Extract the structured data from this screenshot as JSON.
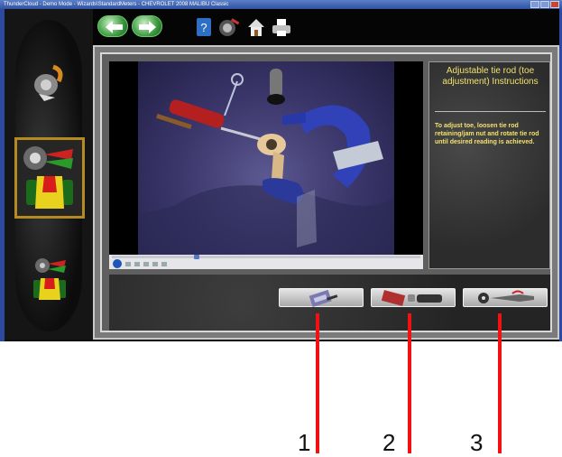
{
  "window": {
    "title": "ThunderCloud - Demo Mode - Wizards\\StandardMeters - CHEVROLET 2008 MALIBU Classic"
  },
  "toolbar": {
    "icons": [
      "back-arrow-icon",
      "forward-arrow-icon",
      "help-icon",
      "wheel-tools-icon",
      "home-icon",
      "printer-icon"
    ]
  },
  "sidebar": {
    "items": [
      {
        "icon": "wheel-adjust-icon",
        "active": false
      },
      {
        "icon": "wheel-alignment-meter-icon",
        "active": true
      },
      {
        "icon": "wheel-alignment-small-icon",
        "active": false
      }
    ]
  },
  "instructions": {
    "title": "Adjustable tie rod (toe adjustment) Instructions",
    "body": "To adjust toe, loosen tie rod retaining/jam nut and rotate tie rod until desired reading is achieved."
  },
  "video": {
    "progress": 0.27
  },
  "buttons": [
    {
      "icon": "measure-tools-icon"
    },
    {
      "icon": "wrench-tools-icon"
    },
    {
      "icon": "tie-rod-tool-icon"
    }
  ],
  "callouts": [
    "1",
    "2",
    "3"
  ],
  "colors": {
    "accent_text": "#f2e26a",
    "callout_line": "#f01212",
    "title_bar": "#2f53a0"
  }
}
